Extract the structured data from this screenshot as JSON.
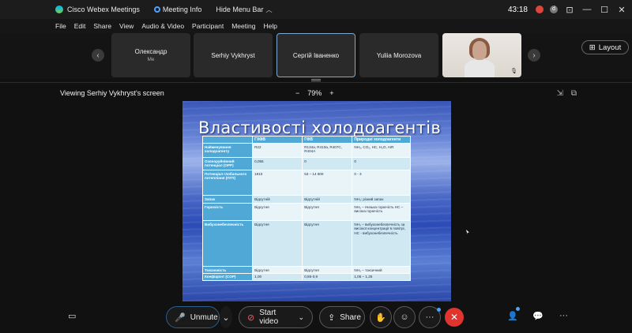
{
  "titlebar": {
    "app_title": "Cisco Webex Meetings",
    "meeting_info": "Meeting Info",
    "hide_menu_bar": "Hide Menu Bar",
    "timer": "43:18",
    "user_initial": "d",
    "window_controls": [
      "⊡",
      "—",
      "☐",
      "✕"
    ]
  },
  "menu": [
    "File",
    "Edit",
    "Share",
    "View",
    "Audio & Video",
    "Participant",
    "Meeting",
    "Help"
  ],
  "participants": [
    {
      "name": "Олександр",
      "sub": "Me",
      "active": false
    },
    {
      "name": "Serhiy Vykhryst",
      "sub": "",
      "active": false
    },
    {
      "name": "Сергій Іваненко",
      "sub": "",
      "active": true
    },
    {
      "name": "Yuliia Morozova",
      "sub": "",
      "active": false
    }
  ],
  "layout_label": "Layout",
  "viewing_text": "Viewing Serhiy Vykhryst's screen",
  "zoom": {
    "minus": "−",
    "level": "79%",
    "plus": "+"
  },
  "slide": {
    "title": "Властивості холодоагентів",
    "headers": [
      "",
      "ГХФВ",
      "ГФВ",
      "Природні холодоагенти"
    ],
    "rows": [
      [
        "Найменування холодоагенту",
        "R22",
        "R134a, R410a, R407C, R404A",
        "NH₃, CO₂, HC, H₂O, AIR"
      ],
      [
        "Озоноруйнівний потенціал (ОРР)",
        "0,055",
        "0",
        "0"
      ],
      [
        "Потенціал глобального потепління (ПГП)",
        "1810",
        "53 – 14 800",
        "0 - 3"
      ],
      [
        "Запах",
        "Відсутній",
        "Відсутній",
        "NH₃: різкий запах"
      ],
      [
        "Горючість",
        "Відсутня",
        "Відсутня",
        "NH₃ – Низька горючість HC – висока горючість"
      ],
      [
        "Вибухонебезпечність",
        "Відсутня",
        "Відсутня",
        "NH₃ – вибухонебезпечність за високої концентрації в повітрі, HC - вибухонебезпечність"
      ],
      [
        "Токсичність",
        "Відсутня",
        "Відсутня",
        "NH₃ – токсичний"
      ],
      [
        "Коефіцієнт (COP)",
        "1,00",
        "0,85-0,9",
        "1,05 – 1,25"
      ]
    ]
  },
  "controls": {
    "unmute": "Unmute",
    "start_video": "Start video",
    "share": "Share"
  },
  "colors": {
    "end_call": "#e0342f",
    "accent": "#4aa3ff",
    "unmute_icon": "#ff5b5b"
  }
}
